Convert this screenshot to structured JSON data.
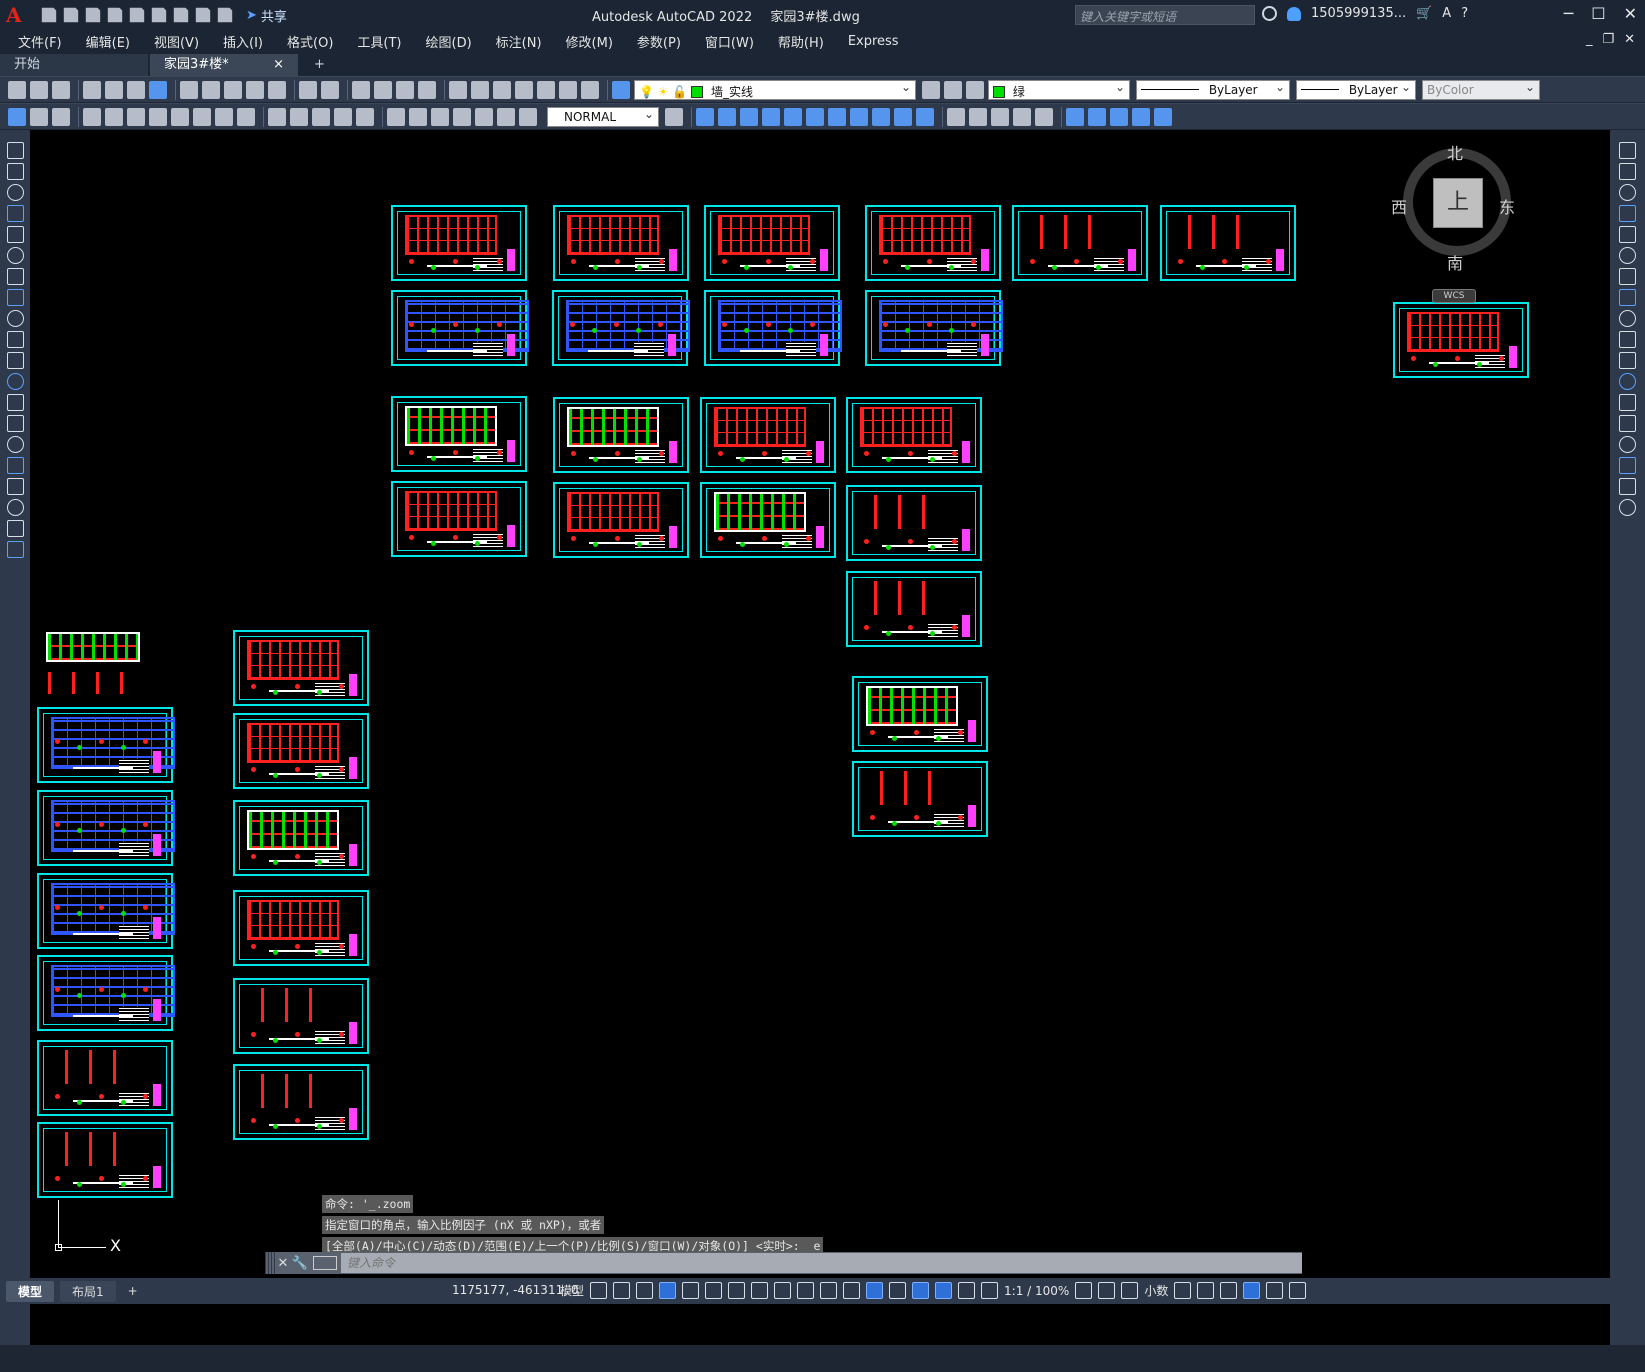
{
  "titlebar": {
    "app_name": "Autodesk AutoCAD 2022",
    "file_name": "家园3#楼.dwg",
    "share_label": "共享",
    "search_placeholder": "键入关键字或短语",
    "user": "1505999135...",
    "logo_letter": "A"
  },
  "menu": [
    "文件(F)",
    "编辑(E)",
    "视图(V)",
    "插入(I)",
    "格式(O)",
    "工具(T)",
    "绘图(D)",
    "标注(N)",
    "修改(M)",
    "参数(P)",
    "窗口(W)",
    "帮助(H)",
    "Express"
  ],
  "tabs": {
    "start": "开始",
    "doc": "家园3#楼*",
    "close": "×",
    "plus": "+"
  },
  "toolbar": {
    "layer": "墙_实线",
    "color": "绿",
    "linetype": "ByLayer",
    "lineweight": "ByLayer",
    "plotstyle": "ByColor",
    "dimstyle": "NORMAL"
  },
  "viewcube": {
    "top": "上",
    "north": "北",
    "south": "南",
    "east": "东",
    "west": "西",
    "wcs": "WCS"
  },
  "ucs": {
    "x_label": "X"
  },
  "command": {
    "history": [
      "命令: '_.zoom",
      "指定窗口的角点，输入比例因子 (nX 或 nXP)，或者",
      "[全部(A)/中心(C)/动态(D)/范围(E)/上一个(P)/比例(S)/窗口(W)/对象(O)] <实时>: _e"
    ],
    "placeholder": "键入命令"
  },
  "status": {
    "model_tab": "模型",
    "layout_tab": "布局1",
    "add_tab": "+",
    "coords": "1175177, -461311, 0",
    "model": "模型",
    "scale": "1:1 / 100%",
    "units": "小数"
  },
  "colors": {
    "canvas": "#000000",
    "frame": "#00e5e5",
    "red": "#ff2020",
    "blue": "#2f55ff",
    "green": "#00e000",
    "magenta": "#ff40ff"
  }
}
